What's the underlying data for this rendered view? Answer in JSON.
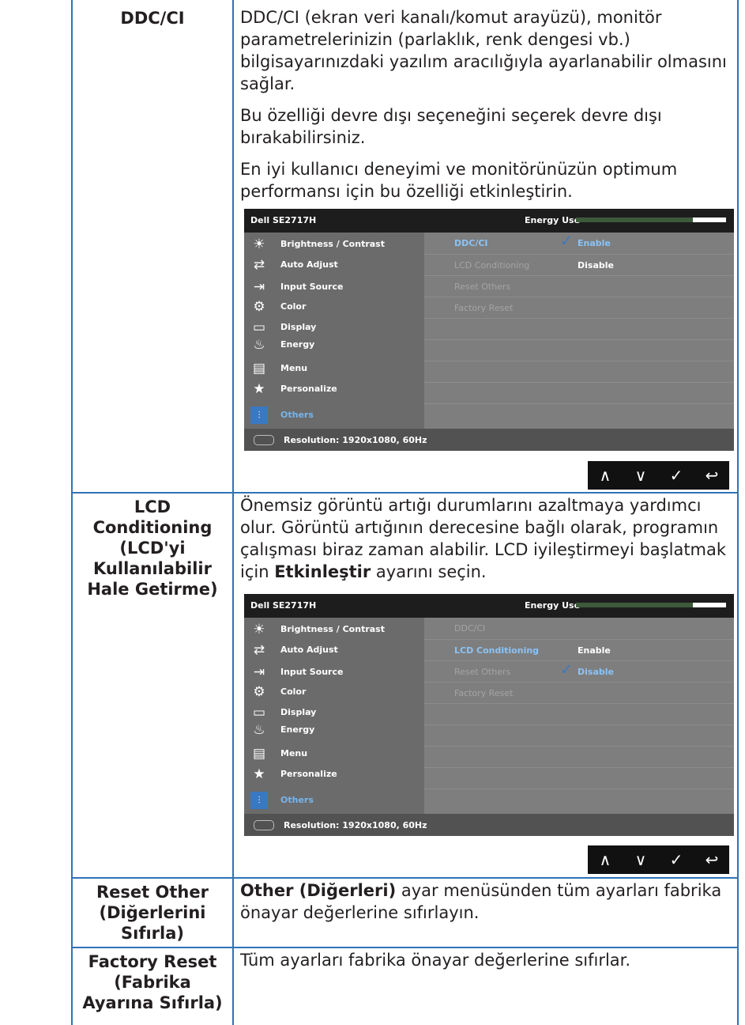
{
  "rows": [
    {
      "label": "DDC/CI",
      "paragraphs": [
        "DDC/CI (ekran veri kanalı/komut arayüzü), monitör parametrelerinizin (parlaklık, renk dengesi vb.) bilgisayarınızdaki yazılım aracılığıyla ayarlanabilir olmasını sağlar.",
        "Bu özelliği devre dışı seçeneğini seçerek devre dışı bırakabilirsiniz.",
        "En iyi kullanıcı deneyimi ve monitörünüzün optimum performansı için bu özelliği etkinleştirin."
      ]
    },
    {
      "label": "LCD Conditioning (LCD'yi Kullanılabilir Hale Getirme)",
      "para_pre": "Önemsiz görüntü artığı durumlarını azaltmaya yardımcı olur. Görüntü artığının derecesine bağlı olarak, programın çalışması biraz zaman alabilir. LCD iyileştirmeyi başlatmak için ",
      "para_bold": "Etkinleştir",
      "para_post": " ayarını seçin."
    },
    {
      "label": "Reset Other (Diğerlerini Sıfırla)",
      "para_bold": "Other (Diğerleri)",
      "para_post": " ayar menüsünden tüm ayarları fabrika önayar değerlerine sıfırlayın."
    },
    {
      "label": "Factory Reset (Fabrika Ayarına Sıfırla)",
      "paragraph": "Tüm ayarları fabrika önayar değerlerine sıfırlar."
    }
  ],
  "osd": {
    "model": "Dell SE2717H",
    "energy_label": "Energy Use",
    "energy_level": 0.78,
    "menu": [
      {
        "label": "Brightness / Contrast",
        "icon": "☀"
      },
      {
        "label": "Auto Adjust",
        "icon": "⇄"
      },
      {
        "label": "Input Source",
        "icon": "⇥"
      },
      {
        "label": "Color",
        "icon": "⚙"
      },
      {
        "label": "Display",
        "icon": "▭"
      },
      {
        "label": "Energy",
        "icon": "♨"
      },
      {
        "label": "Menu",
        "icon": "▤"
      },
      {
        "label": "Personalize",
        "icon": "★"
      },
      {
        "label": "Others",
        "icon": "⫶"
      }
    ],
    "options": [
      "DDC/CI",
      "LCD Conditioning",
      "Reset Others",
      "Factory Reset"
    ],
    "enable": "Enable",
    "disable": "Disable",
    "resolution": "Resolution: 1920x1080, 60Hz"
  },
  "nav": {
    "up": "∧",
    "down": "∨",
    "ok": "✓",
    "back": "↩"
  }
}
